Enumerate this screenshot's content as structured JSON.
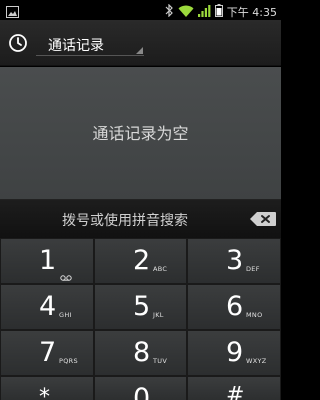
{
  "status_bar": {
    "time": "下午 4:35",
    "icons": [
      "image-notification-icon",
      "bluetooth-icon",
      "wifi-icon",
      "signal-icon",
      "battery-icon"
    ]
  },
  "header": {
    "filter_label": "通话记录"
  },
  "call_log": {
    "empty_message": "通话记录为空"
  },
  "search": {
    "hint": "拨号或使用拼音搜索"
  },
  "dialpad": {
    "keys": [
      {
        "digit": "1",
        "letters": ""
      },
      {
        "digit": "2",
        "letters": "ABC"
      },
      {
        "digit": "3",
        "letters": "DEF"
      },
      {
        "digit": "4",
        "letters": "GHI"
      },
      {
        "digit": "5",
        "letters": "JKL"
      },
      {
        "digit": "6",
        "letters": "MNO"
      },
      {
        "digit": "7",
        "letters": "PQRS"
      },
      {
        "digit": "8",
        "letters": "TUV"
      },
      {
        "digit": "9",
        "letters": "WXYZ"
      },
      {
        "digit": "*",
        "letters": ""
      },
      {
        "digit": "0",
        "letters": "+"
      },
      {
        "digit": "#",
        "letters": ""
      }
    ]
  }
}
